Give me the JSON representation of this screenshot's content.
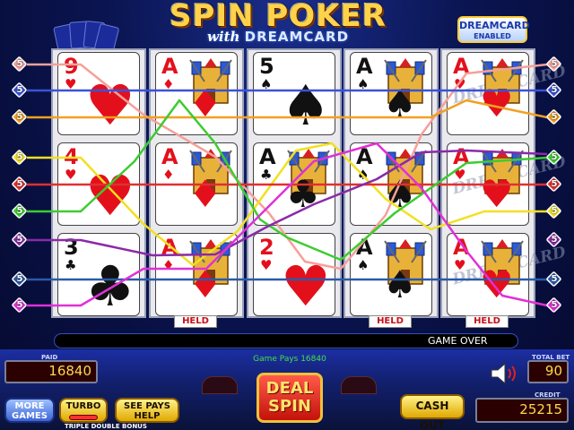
{
  "title": {
    "main": "SPIN POKER",
    "with": "with",
    "sub": "DREAMCARD"
  },
  "badge": {
    "line1": "DREAMCARD",
    "line2": "ENABLED"
  },
  "reels": [
    [
      {
        "rank": "9",
        "suit": "♥",
        "color": "red"
      },
      {
        "rank": "4",
        "suit": "♥",
        "color": "red"
      },
      {
        "rank": "3",
        "suit": "♣",
        "color": "black"
      }
    ],
    [
      {
        "rank": "A",
        "suit": "♦",
        "color": "red",
        "ace": true
      },
      {
        "rank": "A",
        "suit": "♦",
        "color": "red",
        "ace": true
      },
      {
        "rank": "A",
        "suit": "♦",
        "color": "red",
        "ace": true
      }
    ],
    [
      {
        "rank": "5",
        "suit": "♠",
        "color": "black"
      },
      {
        "rank": "A",
        "suit": "♣",
        "color": "black",
        "ace": true
      },
      {
        "rank": "2",
        "suit": "♥",
        "color": "red"
      }
    ],
    [
      {
        "rank": "A",
        "suit": "♠",
        "color": "black",
        "ace": true
      },
      {
        "rank": "A",
        "suit": "♠",
        "color": "black",
        "ace": true
      },
      {
        "rank": "A",
        "suit": "♠",
        "color": "black",
        "ace": true
      }
    ],
    [
      {
        "rank": "A",
        "suit": "♥",
        "color": "red",
        "ace": true,
        "dream": true
      },
      {
        "rank": "A",
        "suit": "♥",
        "color": "red",
        "ace": true,
        "dream": true
      },
      {
        "rank": "A",
        "suit": "♥",
        "color": "red",
        "ace": true,
        "dream": true
      }
    ]
  ],
  "dream_text": "DREAMCARD",
  "held_label": "HELD",
  "held_columns": [
    1,
    3,
    4
  ],
  "paylines": {
    "left": [
      {
        "num": "5",
        "color": "#f5a09a"
      },
      {
        "num": "5",
        "color": "#3a52d8"
      },
      {
        "num": "5",
        "color": "#f2a020"
      },
      {
        "num": "5",
        "color": "#f2e020"
      },
      {
        "num": "5",
        "color": "#e03030"
      },
      {
        "num": "5",
        "color": "#3ccc30"
      },
      {
        "num": "5",
        "color": "#8a2aa8"
      },
      {
        "num": "5",
        "color": "#2a5aa8"
      },
      {
        "num": "5",
        "color": "#e030d8"
      }
    ],
    "right": [
      {
        "num": "5",
        "color": "#f5a09a"
      },
      {
        "num": "5",
        "color": "#3a52d8"
      },
      {
        "num": "5",
        "color": "#f2a020"
      },
      {
        "num": "5",
        "color": "#3ccc30"
      },
      {
        "num": "5",
        "color": "#e03030"
      },
      {
        "num": "5",
        "color": "#f2e020"
      },
      {
        "num": "5",
        "color": "#8a2aa8"
      },
      {
        "num": "5",
        "color": "#2a5aa8"
      },
      {
        "num": "5",
        "color": "#e030d8"
      }
    ]
  },
  "message": "GAME OVER",
  "game_pays": "Game Pays 16840",
  "paid": {
    "label": "PAID",
    "value": "16840"
  },
  "total_bet": {
    "label": "TOTAL BET",
    "value": "90"
  },
  "credit": {
    "label": "CREDIT",
    "value": "25215"
  },
  "buttons": {
    "more_games": "MORE GAMES",
    "turbo": "TURBO",
    "see_pays": "SEE PAYS HELP",
    "deal_spin": "DEAL SPIN",
    "cash_out": "CASH OUT"
  },
  "game_name": "TRIPLE DOUBLE BONUS"
}
